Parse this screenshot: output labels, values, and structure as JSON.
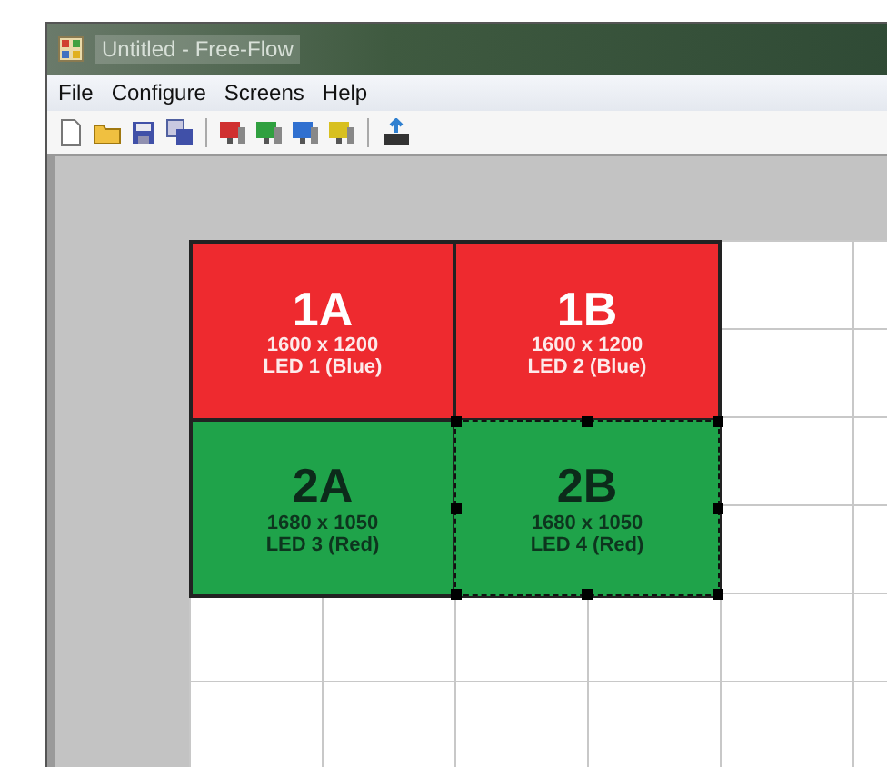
{
  "window": {
    "title": "Untitled - Free-Flow"
  },
  "menu": [
    "File",
    "Configure",
    "Screens",
    "Help"
  ],
  "toolbar": [
    {
      "kind": "new"
    },
    {
      "kind": "open"
    },
    {
      "kind": "save"
    },
    {
      "kind": "saveall"
    },
    {
      "kind": "sep"
    },
    {
      "kind": "monitor",
      "color": "#d03030"
    },
    {
      "kind": "monitor",
      "color": "#30a040"
    },
    {
      "kind": "monitor",
      "color": "#3070d0"
    },
    {
      "kind": "monitor",
      "color": "#d8c020"
    },
    {
      "kind": "sep"
    },
    {
      "kind": "export"
    }
  ],
  "screens": [
    {
      "name": "1A",
      "resolution": "1600 x 1200",
      "output": "LED 1 (Blue)",
      "color": "#ee2a2f",
      "selected": false
    },
    {
      "name": "1B",
      "resolution": "1600 x 1200",
      "output": "LED 2 (Blue)",
      "color": "#ee2a2f",
      "selected": false
    },
    {
      "name": "2A",
      "resolution": "1680 x 1050",
      "output": "LED 3 (Red)",
      "color": "#1fa34a",
      "selected": false
    },
    {
      "name": "2B",
      "resolution": "1680 x 1050",
      "output": "LED 4 (Red)",
      "color": "#1fa34a",
      "selected": true
    }
  ]
}
